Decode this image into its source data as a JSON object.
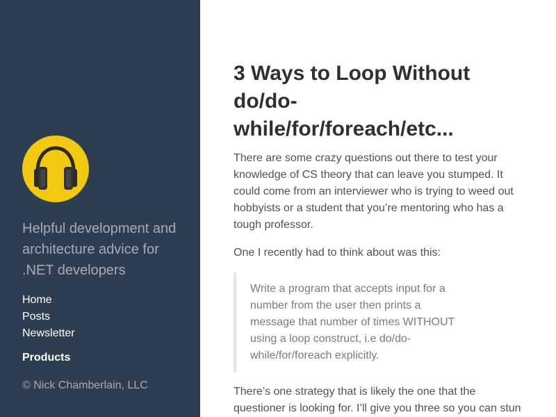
{
  "sidebar": {
    "avatar_icon": "headphones-icon",
    "avatar_color": "#f2c811",
    "background_color": "#2d3e50",
    "tagline": "Helpful development and architecture advice for .NET developers",
    "nav": [
      {
        "label": "Home"
      },
      {
        "label": "Posts"
      },
      {
        "label": "Newsletter"
      }
    ],
    "products_label": "Products",
    "copyright": "© Nick Chamberlain, LLC"
  },
  "post": {
    "title": "3 Ways to Loop Without do/do-while/for/foreach/etc...",
    "intro": "There are some crazy questions out there to test your knowledge of CS theory that can leave you stumped. It could come from an interviewer who is trying to weed out hobbyists or a student that you’re mentoring who has a tough professor.",
    "lead_in": "One I recently had to think about was this:",
    "quote": "Write a program that accepts input for a number from the user then prints a message that number of times WITHOUT using a loop construct, i.e do/do-while/for/foreach explicitly.",
    "continuation": "There’s one strategy that is likely the one that the questioner is looking for. I’ll give you three so you can stun them."
  }
}
